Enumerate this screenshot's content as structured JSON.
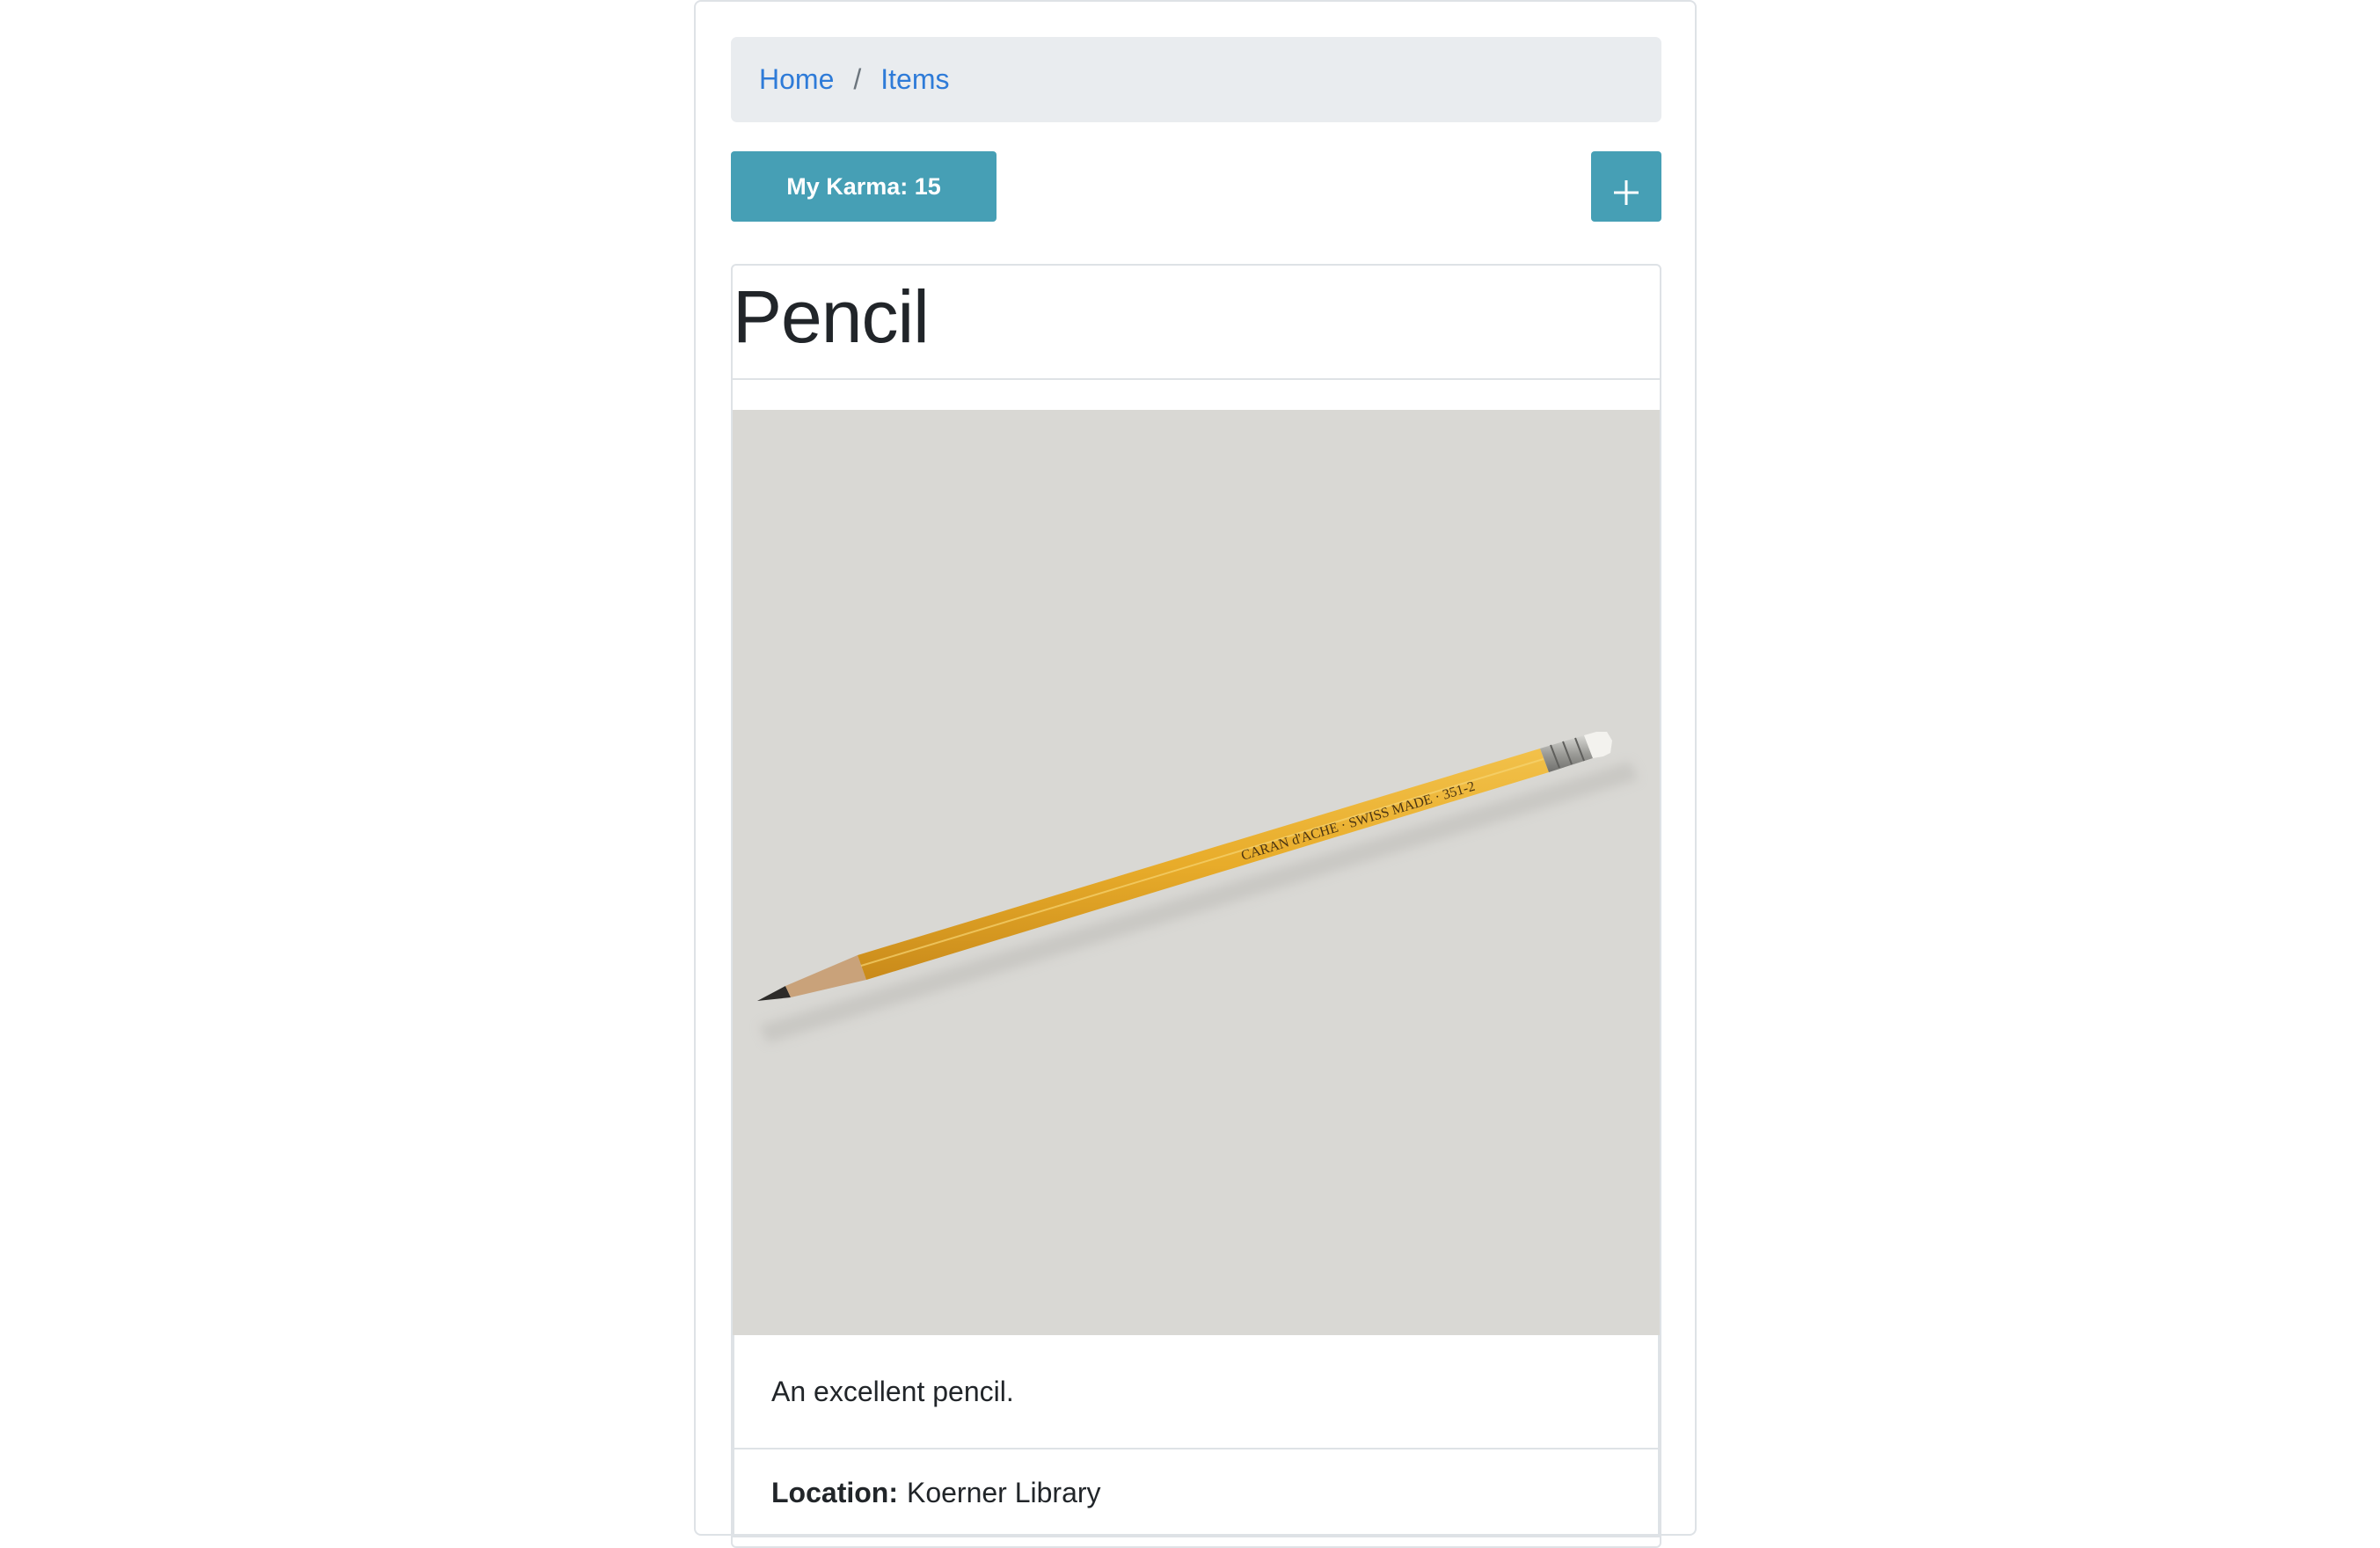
{
  "breadcrumb": {
    "home_label": "Home",
    "separator": "/",
    "items_label": "Items"
  },
  "toolbar": {
    "karma_label": "My Karma: 15",
    "add_icon": "plus-icon"
  },
  "item": {
    "title": "Pencil",
    "image_alt": "pencil",
    "image_bg": "#d9d8d4",
    "description": "An excellent pencil.",
    "location_label": "Location:",
    "location_value": "Koerner Library"
  },
  "colors": {
    "accent": "#469fb5",
    "link": "#2e7bd8",
    "breadcrumb_bg": "#e9ecef",
    "border": "#dee2e6"
  }
}
